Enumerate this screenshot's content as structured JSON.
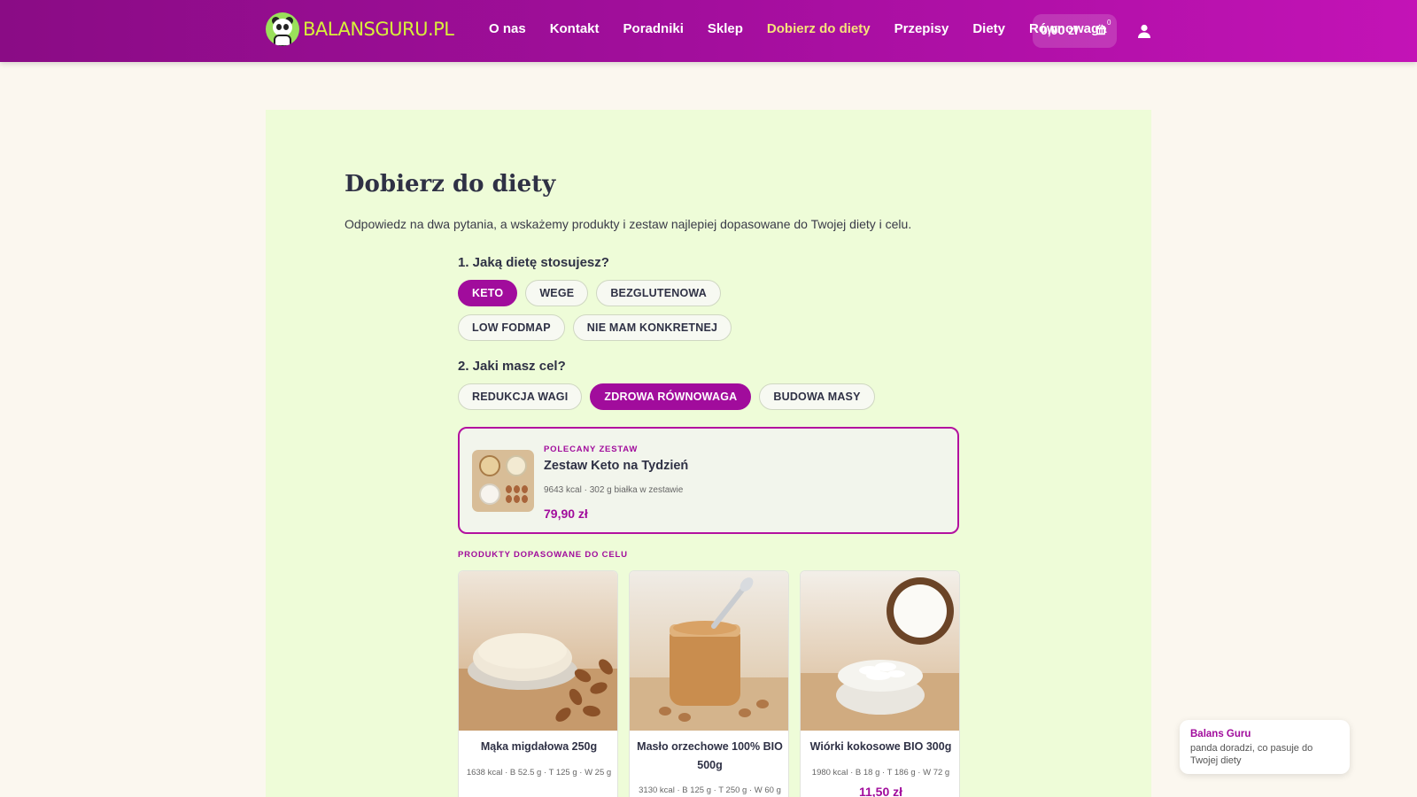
{
  "header": {
    "logo_text": "BALANSGURU.PL",
    "nav": [
      {
        "label": "O nas"
      },
      {
        "label": "Kontakt"
      },
      {
        "label": "Poradniki"
      },
      {
        "label": "Sklep"
      },
      {
        "label": "Dobierz do diety",
        "active": true
      },
      {
        "label": "Przepisy"
      },
      {
        "label": "Diety"
      },
      {
        "label": "Równowaga"
      }
    ],
    "cart_amount": "0,00 zł",
    "cart_count": "0",
    "colors": {
      "brand": "#a10c9c",
      "active_nav": "#f6e27a",
      "logo_text": "#d8ef3a"
    }
  },
  "page": {
    "title": "Dobierz do diety",
    "intro": "Odpowiedz na dwa pytania, a wskażemy produkty i zestaw najlepiej dopasowane do Twojej diety i celu."
  },
  "quiz": {
    "q1": {
      "label": "1. Jaką dietę stosujesz?",
      "options": [
        "KETO",
        "WEGE",
        "BEZGLUTENOWA",
        "LOW FODMAP",
        "NIE MAM KONKRETNEJ"
      ],
      "selected": "KETO"
    },
    "q2": {
      "label": "2. Jaki masz cel?",
      "options": [
        "REDUKCJA WAGI",
        "ZDROWA RÓWNOWAGA",
        "BUDOWA MASY"
      ],
      "selected": "ZDROWA RÓWNOWAGA"
    }
  },
  "recommended_set": {
    "eyebrow": "POLECANY ZESTAW",
    "name": "Zestaw Keto na Tydzień",
    "meta": "9643 kcal · 302 g białka w zestawie",
    "price": "79,90 zł"
  },
  "products_section_label": "PRODUKTY DOPASOWANE DO CELU",
  "products": [
    {
      "name": "Mąka migdałowa 250g",
      "meta": "1638 kcal · B 52.5 g · T 125 g · W 25 g",
      "price": ""
    },
    {
      "name": "Masło orzechowe 100% BIO 500g",
      "meta": "3130 kcal · B 125 g · T 250 g · W 60 g",
      "price": ""
    },
    {
      "name": "Wiórki kokosowe BIO 300g",
      "meta": "1980 kcal · B 18 g · T 186 g · W 72 g",
      "price": "11,50 zł"
    }
  ],
  "chat": {
    "name": "Balans Guru",
    "text": "panda doradzi, co pasuje do Twojej diety"
  }
}
